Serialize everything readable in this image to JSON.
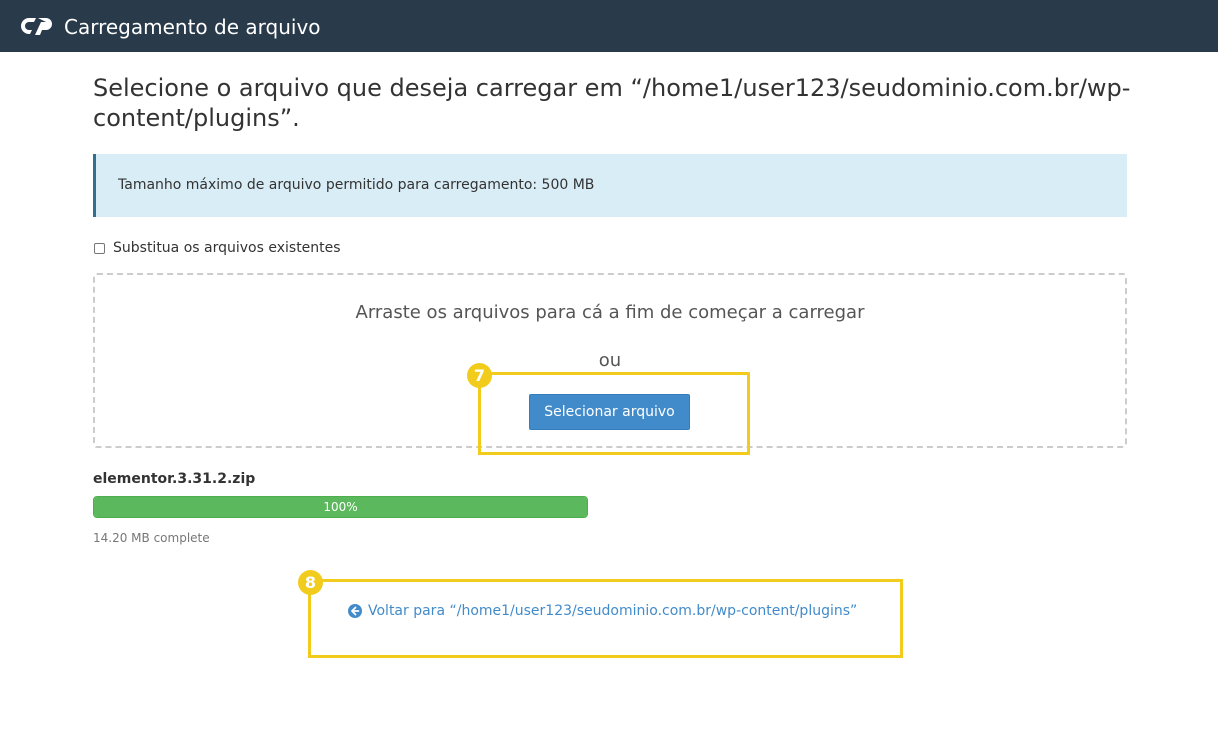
{
  "header": {
    "title": "Carregamento de arquivo",
    "logo_icon": "cpanel-logo-icon",
    "bg_color": "#293a4a"
  },
  "main": {
    "heading": "Selecione o arquivo que deseja carregar em “/home1/user123/seudominio.com.br/wp-content/plugins”.",
    "info": "Tamanho máximo de arquivo permitido para carregamento: 500 MB",
    "overwrite_label": "Substitua os arquivos existentes",
    "overwrite_checked": false,
    "dropzone_text": "Arraste os arquivos para cá a fim de começar a carregar",
    "or_text": "ou",
    "select_button": "Selecionar arquivo",
    "upload": {
      "filename": "elementor.3.31.2.zip",
      "progress_label": "100%",
      "progress": 1.0,
      "status": "14.20 MB complete"
    },
    "back_link": "Voltar para “/home1/user123/seudominio.com.br/wp-content/plugins”",
    "back_icon": "arrow-circle-left-icon"
  },
  "annotations": {
    "badge_7": "7",
    "badge_8": "8",
    "highlight_color": "#f2cc1d"
  }
}
